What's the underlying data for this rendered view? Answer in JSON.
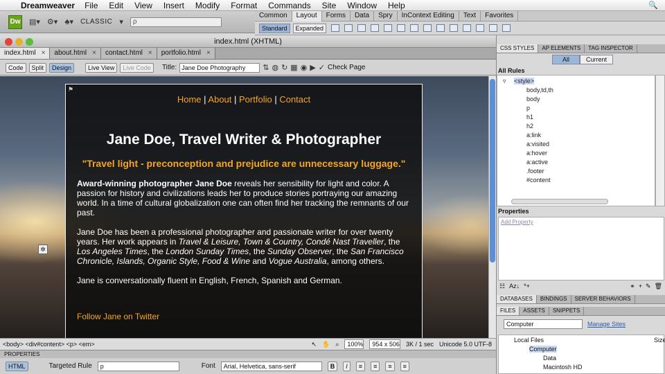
{
  "menubar": {
    "app": "Dreamweaver",
    "items": [
      "File",
      "Edit",
      "View",
      "Insert",
      "Modify",
      "Format",
      "Commands",
      "Site",
      "Window",
      "Help"
    ]
  },
  "appbar": {
    "logo": "Dw",
    "workspace": "CLASSIC",
    "search_placeholder": "ρ"
  },
  "insert": {
    "tabs": [
      "Common",
      "Layout",
      "Forms",
      "Data",
      "Spry",
      "InContext Editing",
      "Text",
      "Favorites"
    ],
    "active": "Layout",
    "modes": [
      "Standard",
      "Expanded"
    ]
  },
  "document": {
    "window_title": "index.html (XHTML)",
    "tabs": [
      "index.html",
      "about.html",
      "contact.html",
      "portfolio.html"
    ],
    "toolbar": {
      "code": "Code",
      "split": "Split",
      "design": "Design",
      "live_view": "Live View",
      "live_code": "Live Code",
      "title_label": "Title:",
      "title_value": "Jane Doe Photography",
      "check_page": "Check Page"
    }
  },
  "page": {
    "nav": [
      "Home",
      "About",
      "Portfolio",
      "Contact"
    ],
    "heading": "Jane Doe, Travel Writer & Photographer",
    "quote": "\"Travel light - preconception and prejudice are unnecessary luggage.\"",
    "p1_bold": "Award-winning photographer Jane Doe",
    "p1_rest": " reveals her sensibility for light and color. A passion for history and civilizations leads her to produce stories portraying our amazing world. In a time of cultural globalization one can often find her tracking the remnants of our past.",
    "p2_a": "Jane Doe has been a professional photographer and passionate writer for over twenty years. Her work appears in ",
    "p2_i1": "Travel & Leisure, Town & Country, Condé Nast Traveller",
    "p2_b": ", the ",
    "p2_i2": "Los Angeles Times",
    "p2_c": ", the ",
    "p2_i3": "London Sunday Times",
    "p2_d": ", the ",
    "p2_i4": "Sunday Observer",
    "p2_e": ", the ",
    "p2_i5": "San Francisco Chronicle, Islands, Organic Style, Food & Wine",
    "p2_f": " and ",
    "p2_i6": "Vogue Australia",
    "p2_g": ", among others.",
    "p3": "Jane is conversationally fluent in English, French, Spanish and German.",
    "twitter": "Follow Jane on Twitter"
  },
  "status": {
    "path": "<body> <div#content> <p> <em>",
    "zoom": "100%",
    "size": "954 x 506",
    "weight": "3K / 1 sec",
    "encoding": "Unicode 5.0 UTF-8"
  },
  "properties": {
    "label": "PROPERTIES",
    "html": "HTML",
    "targeted_rule_label": "Targeted Rule",
    "targeted_rule": "p",
    "font_label": "Font",
    "font": "Arial, Helvetica, sans-serif"
  },
  "css_panel": {
    "tabs": [
      "CSS STYLES",
      "AP ELEMENTS",
      "TAG INSPECTOR"
    ],
    "modes": [
      "All",
      "Current"
    ],
    "all_rules": "All Rules",
    "rules": [
      "<style>",
      "body,td,th",
      "body",
      "p",
      "h1",
      "h2",
      "a:link",
      "a:visited",
      "a:hover",
      "a:active",
      ".footer",
      "#content"
    ],
    "properties": "Properties",
    "add_property": "Add Property"
  },
  "db_panel": {
    "tabs": [
      "DATABASES",
      "BINDINGS",
      "SERVER BEHAVIORS"
    ]
  },
  "files_panel": {
    "tabs": [
      "FILES",
      "ASSETS",
      "SNIPPETS"
    ],
    "location": "Computer",
    "manage_sites": "Manage Sites",
    "col_local": "Local Files",
    "col_size": "Size",
    "items": [
      "Computer",
      "Data",
      "Macintosh HD"
    ]
  }
}
